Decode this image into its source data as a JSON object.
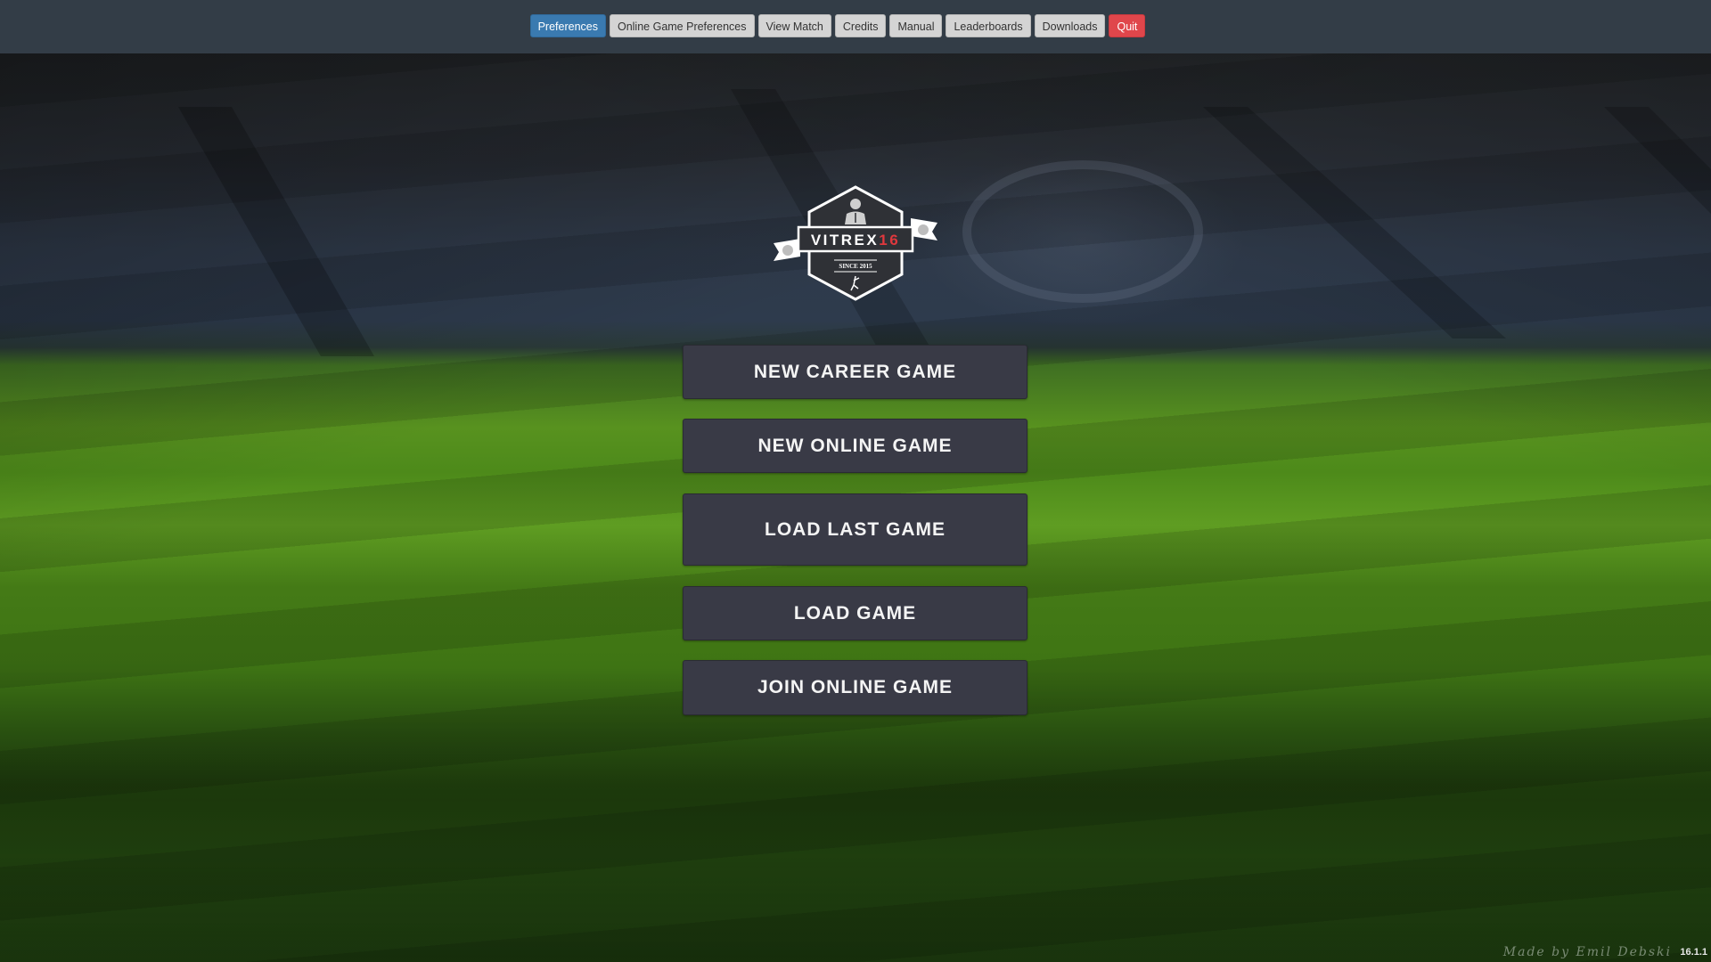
{
  "navbar": {
    "buttons": [
      {
        "label": "Preferences",
        "style": "primary"
      },
      {
        "label": "Online Game Preferences",
        "style": "default"
      },
      {
        "label": "View Match",
        "style": "default"
      },
      {
        "label": "Credits",
        "style": "default"
      },
      {
        "label": "Manual",
        "style": "default"
      },
      {
        "label": "Leaderboards",
        "style": "default"
      },
      {
        "label": "Downloads",
        "style": "default"
      },
      {
        "label": "Quit",
        "style": "danger"
      }
    ]
  },
  "logo": {
    "brand_text": "VITREX",
    "brand_number": "16",
    "since_text": "SINCE 2015",
    "brand_color": "#ffffff",
    "number_color": "#e0383d"
  },
  "main_menu": {
    "buttons": [
      {
        "label": "NEW CAREER GAME"
      },
      {
        "label": "NEW ONLINE GAME"
      },
      {
        "label": "LOAD LAST GAME"
      },
      {
        "label": "LOAD GAME"
      },
      {
        "label": "JOIN ONLINE GAME"
      }
    ]
  },
  "footer": {
    "signature": "Made by Emil Debski",
    "version": "16.1.1"
  },
  "colors": {
    "navbar_bg": "#333d47",
    "primary": "#3a7ab0",
    "danger": "#e0464b",
    "menu_button_bg": "#393a46"
  }
}
